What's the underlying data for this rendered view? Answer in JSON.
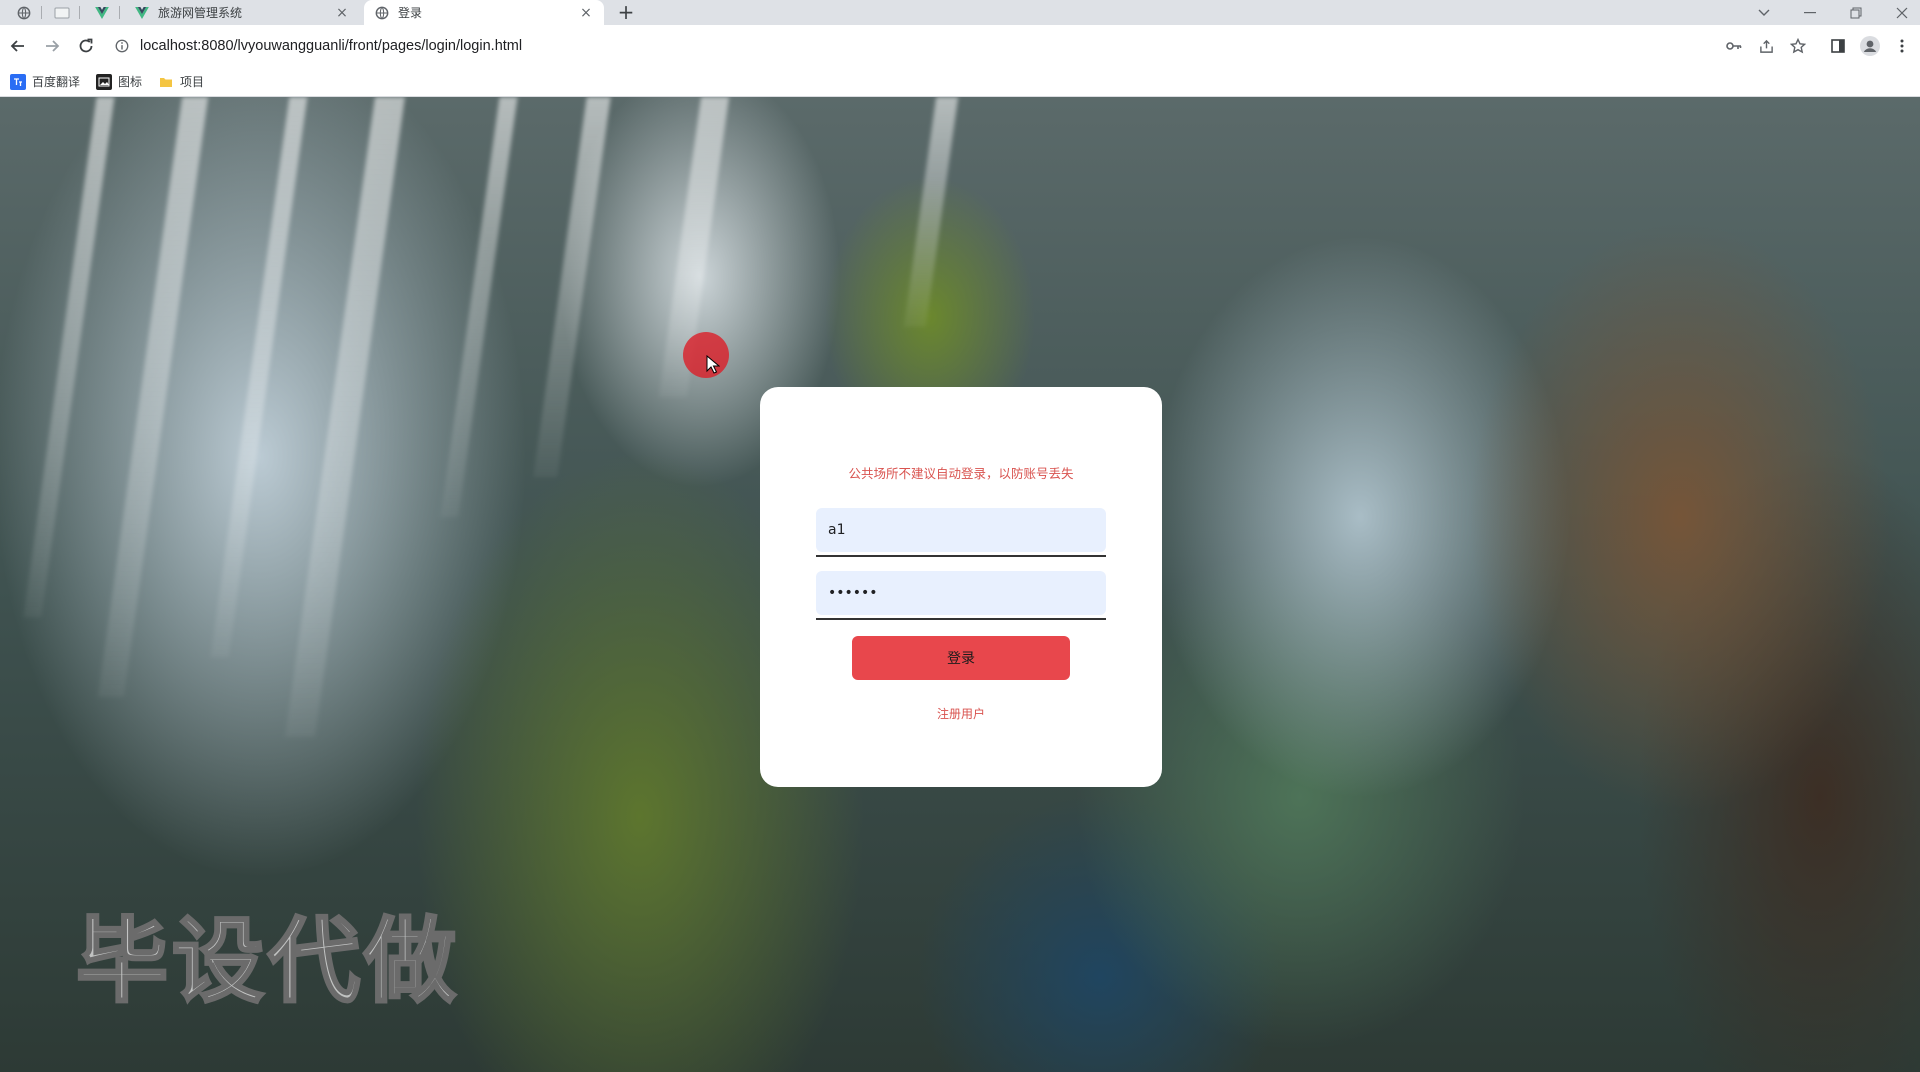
{
  "tabs": [
    {
      "title": "旅游网管理系统",
      "close": "×",
      "icon": "vue-logo-icon",
      "active": false
    },
    {
      "title": "登录",
      "close": "×",
      "icon": "globe-icon",
      "active": true
    }
  ],
  "new_tab_label": "+",
  "address_bar": {
    "url": "localhost:8080/lvyouwangguanli/front/pages/login/login.html"
  },
  "bookmarks": [
    {
      "label": "百度翻译",
      "icon": "baidu-translate-icon"
    },
    {
      "label": "图标",
      "icon": "image-icon"
    },
    {
      "label": "项目",
      "icon": "folder-icon"
    }
  ],
  "login": {
    "notice": "公共场所不建议自动登录，以防账号丢失",
    "username_value": "a1",
    "password_value": "123456",
    "submit_label": "登录",
    "register_label": "注册用户"
  },
  "watermark": "毕设代做",
  "colors": {
    "accent": "#e8474c",
    "notice_text": "#d9534f",
    "input_bg": "#e8f0fe",
    "chrome_bg": "#dee1e6"
  }
}
